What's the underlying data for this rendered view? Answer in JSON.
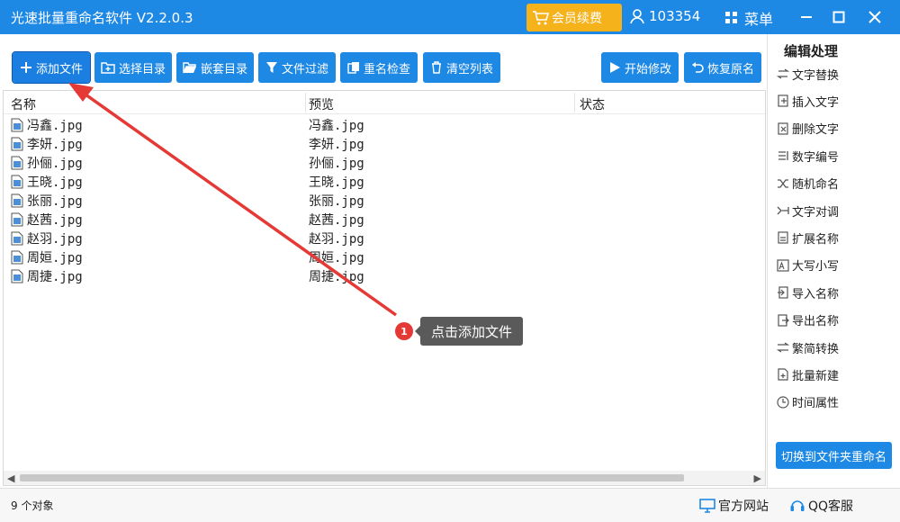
{
  "app": {
    "title": "光速批量重命名软件 V2.2.0.3"
  },
  "titlebar": {
    "vip_label": "会员续费",
    "user_id": "103354",
    "menu_label": "菜单"
  },
  "toolbar": {
    "add_file": "添加文件",
    "select_dir": "选择目录",
    "nested_dir": "嵌套目录",
    "file_filter": "文件过滤",
    "rename_check": "重名检查",
    "clear_list": "清空列表",
    "start_modify": "开始修改",
    "restore_name": "恢复原名"
  },
  "table": {
    "columns": [
      "名称",
      "预览",
      "状态"
    ],
    "rows": [
      {
        "name": "冯鑫.jpg",
        "preview": "冯鑫.jpg"
      },
      {
        "name": "李妍.jpg",
        "preview": "李妍.jpg"
      },
      {
        "name": "孙俪.jpg",
        "preview": "孙俪.jpg"
      },
      {
        "name": "王晓.jpg",
        "preview": "王晓.jpg"
      },
      {
        "name": "张丽.jpg",
        "preview": "张丽.jpg"
      },
      {
        "name": "赵茜.jpg",
        "preview": "赵茜.jpg"
      },
      {
        "name": "赵羽.jpg",
        "preview": "赵羽.jpg"
      },
      {
        "name": "周姮.jpg",
        "preview": "周姮.jpg"
      },
      {
        "name": "周捷.jpg",
        "preview": "周捷.jpg"
      }
    ]
  },
  "sidebar": {
    "title": "编辑处理",
    "items": [
      {
        "label": "文字替换",
        "icon": "swap-icon"
      },
      {
        "label": "插入文字",
        "icon": "insert-icon"
      },
      {
        "label": "删除文字",
        "icon": "delete-text-icon"
      },
      {
        "label": "数字编号",
        "icon": "number-icon"
      },
      {
        "label": "随机命名",
        "icon": "shuffle-icon"
      },
      {
        "label": "文字对调",
        "icon": "exchange-icon"
      },
      {
        "label": "扩展名称",
        "icon": "extension-icon"
      },
      {
        "label": "大写小写",
        "icon": "case-icon"
      },
      {
        "label": "导入名称",
        "icon": "import-icon"
      },
      {
        "label": "导出名称",
        "icon": "export-icon"
      },
      {
        "label": "繁简转换",
        "icon": "convert-icon"
      },
      {
        "label": "批量新建",
        "icon": "new-batch-icon"
      },
      {
        "label": "时间属性",
        "icon": "clock-icon"
      }
    ],
    "switch_label": "切换到文件夹重命名"
  },
  "status": {
    "count": "9 个对象",
    "website": "官方网站",
    "qq": "QQ客服"
  },
  "annotation": {
    "badge": "1",
    "tip": "点击添加文件"
  },
  "colors": {
    "primary": "#1e88e5",
    "vip": "#f6b21b",
    "badge": "#e53935",
    "arrow": "#e53935"
  }
}
